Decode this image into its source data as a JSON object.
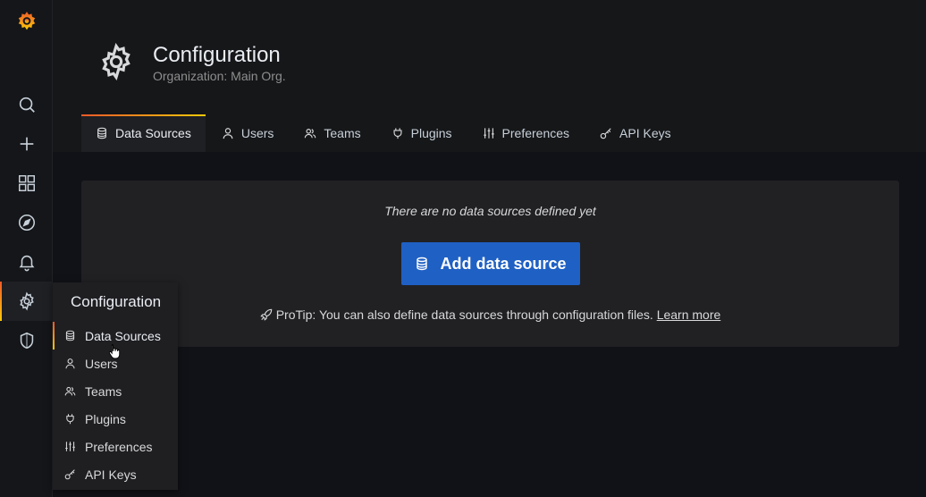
{
  "header": {
    "title": "Configuration",
    "subtitle": "Organization: Main Org."
  },
  "tabs": [
    {
      "label": "Data Sources",
      "icon": "database-icon",
      "active": true
    },
    {
      "label": "Users",
      "icon": "user-icon"
    },
    {
      "label": "Teams",
      "icon": "users-icon"
    },
    {
      "label": "Plugins",
      "icon": "plug-icon"
    },
    {
      "label": "Preferences",
      "icon": "sliders-icon"
    },
    {
      "label": "API Keys",
      "icon": "key-icon"
    }
  ],
  "sidebar": {
    "items": [
      {
        "icon": "grafana-logo"
      },
      {
        "icon": "search-icon"
      },
      {
        "icon": "plus-icon"
      },
      {
        "icon": "dashboards-icon"
      },
      {
        "icon": "explore-icon"
      },
      {
        "icon": "bell-icon"
      },
      {
        "icon": "gear-icon",
        "active": true
      },
      {
        "icon": "shield-icon"
      }
    ]
  },
  "empty_state": {
    "title": "There are no data sources defined yet",
    "button_label": "Add data source",
    "protip": "ProTip: You can also define data sources through configuration files.",
    "learn_more": "Learn more"
  },
  "flyout": {
    "title": "Configuration",
    "items": [
      {
        "label": "Data Sources",
        "active": true
      },
      {
        "label": "Users"
      },
      {
        "label": "Teams"
      },
      {
        "label": "Plugins"
      },
      {
        "label": "Preferences"
      },
      {
        "label": "API Keys"
      }
    ]
  },
  "colors": {
    "accent_start": "#f05a28",
    "accent_end": "#fbca0a",
    "primary_button": "#1f60c4"
  }
}
